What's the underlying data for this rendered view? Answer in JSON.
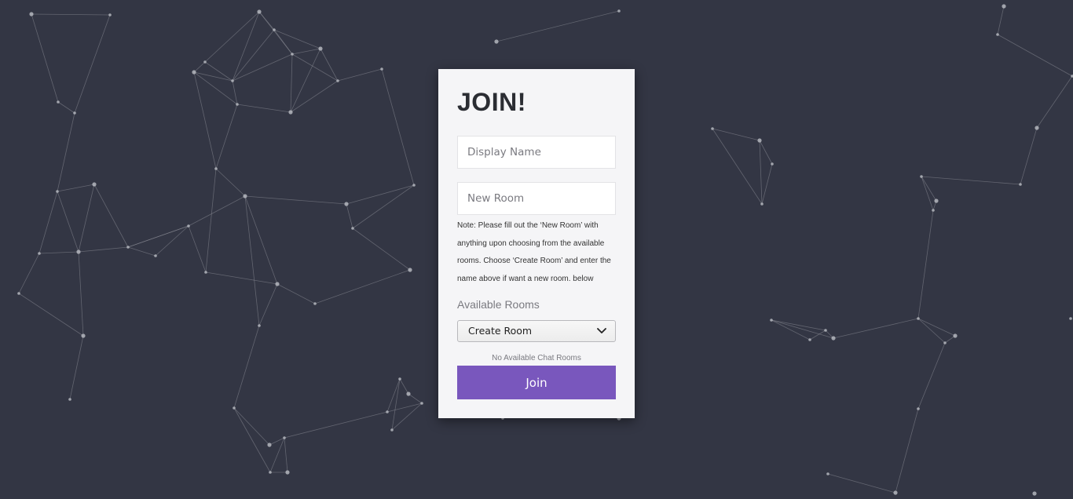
{
  "form": {
    "title": "JOIN!",
    "display_name_placeholder": "Display Name",
    "display_name_value": "",
    "new_room_placeholder": "New Room",
    "new_room_value": "",
    "note": "Note: Please fill out the ‘New Room’ with anything upon choosing from the available rooms. Choose ‘Create Room’ and enter the name above if want a new room. below",
    "rooms_label": "Available Rooms",
    "rooms_select": {
      "selected": "Create Room"
    },
    "rooms_status": "No Available Chat Rooms",
    "join_label": "Join"
  },
  "colors": {
    "background": "#333644",
    "card": "#f5f5f7",
    "accent": "#7957bd",
    "network_lines": "#8a8d96"
  },
  "icons": {
    "select_arrow": "chevron-down-icon"
  }
}
